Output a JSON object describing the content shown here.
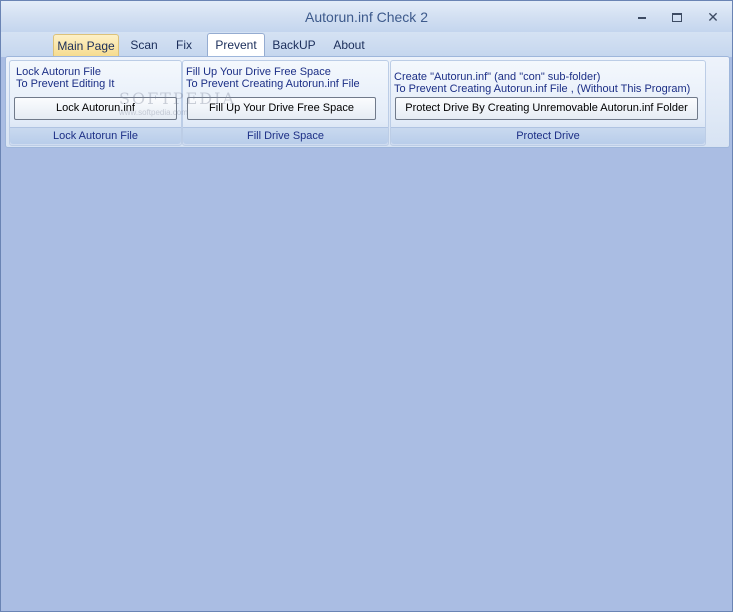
{
  "window": {
    "title": "Autorun.inf Check 2",
    "controls": {
      "minimize": "minimize",
      "maximize": "maximize",
      "close": "✕"
    }
  },
  "tabs": [
    "Main Page",
    "Scan",
    "Fix",
    "Prevent",
    "BackUP",
    "About"
  ],
  "active_tab": "Prevent",
  "hover_tab": "Main Page",
  "groups": [
    {
      "desc_line1": "Lock Autorun File",
      "desc_line2": "To Prevent Editing It",
      "button": "Lock Autorun.inf",
      "caption": "Lock Autorun File"
    },
    {
      "desc_line1": "Fill Up Your Drive Free Space",
      "desc_line2": "To Prevent Creating Autorun.inf File",
      "button": "Fill Up Your Drive Free Space",
      "caption": "Fill Drive Space"
    },
    {
      "desc_line1": "Create \"Autorun.inf\" (and \"con\" sub-folder)",
      "desc_line2": "To Prevent Creating Autorun.inf File , (Without This Program)",
      "button": "Protect Drive By Creating Unremovable Autorun.inf Folder",
      "caption": "Protect Drive"
    }
  ],
  "watermark": {
    "text": "SOFTPEDIA",
    "sub": "www.softpedia.com"
  },
  "colors": {
    "background": "#aabde3",
    "accent_text": "#1c2f86",
    "title_text": "#3d5a8c"
  }
}
